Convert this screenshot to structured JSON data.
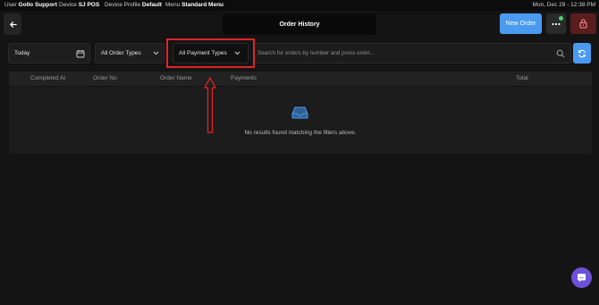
{
  "status": {
    "user_label": "User",
    "user_value": "Gollo Support",
    "device_label": "Device",
    "device_value": "SJ POS",
    "profile_label": "Device Profile",
    "profile_value": "Default",
    "menu_label": "Menu",
    "menu_value": "Standard Menu",
    "datetime": "Mon, Dec 29 - 12:38 PM"
  },
  "header": {
    "title": "Order History",
    "new_order_label": "New Order"
  },
  "filters": {
    "date_value": "Today",
    "order_types_value": "All Order Types",
    "payment_types_value": "All Payment Types",
    "search_placeholder": "Search for orders by number and press enter..."
  },
  "table": {
    "columns": [
      "Completed At",
      "Order No",
      "Order Name",
      "Payments",
      "Total"
    ],
    "empty_message": "No results found matching the filters above."
  },
  "colors": {
    "accent": "#4a9bf0",
    "highlight": "#e0242a",
    "lock_button": "#5a1d1d",
    "chat_button": "#6d52d9",
    "status_dot": "#4bd36a"
  },
  "icons": {
    "back": "arrow-left-icon",
    "more": "ellipsis-icon",
    "lock": "lock-icon",
    "calendar": "calendar-icon",
    "chevron": "chevron-down-icon",
    "search": "search-icon",
    "refresh": "refresh-icon",
    "empty": "inbox-icon",
    "chat": "chat-icon",
    "annotation": "up-arrow-annotation"
  }
}
